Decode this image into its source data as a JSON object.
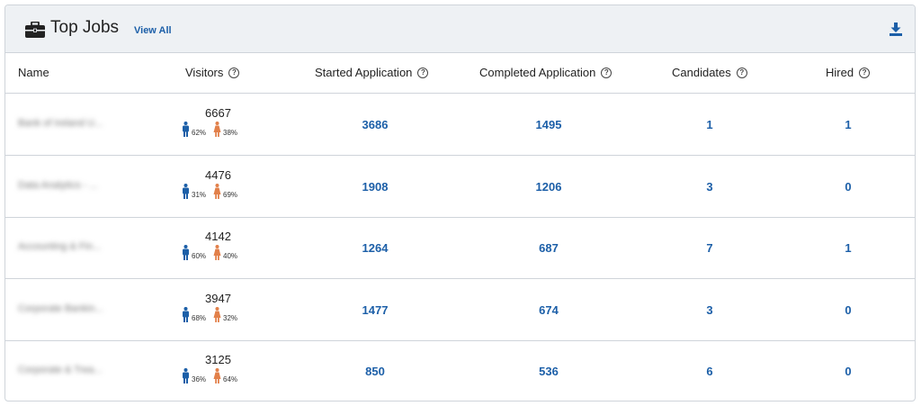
{
  "header": {
    "title": "Top Jobs",
    "view_all": "View All"
  },
  "columns": {
    "name": "Name",
    "visitors": "Visitors",
    "started": "Started Application",
    "completed": "Completed Application",
    "candidates": "Candidates",
    "hired": "Hired",
    "help_glyph": "?"
  },
  "rows": [
    {
      "name": "Bank of Ireland U...",
      "visitors": "6667",
      "male": "62%",
      "female": "38%",
      "started": "3686",
      "completed": "1495",
      "candidates": "1",
      "hired": "1"
    },
    {
      "name": "Data Analytics - ...",
      "visitors": "4476",
      "male": "31%",
      "female": "69%",
      "started": "1908",
      "completed": "1206",
      "candidates": "3",
      "hired": "0"
    },
    {
      "name": "Accounting & Fin...",
      "visitors": "4142",
      "male": "60%",
      "female": "40%",
      "started": "1264",
      "completed": "687",
      "candidates": "7",
      "hired": "1"
    },
    {
      "name": "Corporate Bankin...",
      "visitors": "3947",
      "male": "68%",
      "female": "32%",
      "started": "1477",
      "completed": "674",
      "candidates": "3",
      "hired": "0"
    },
    {
      "name": "Corporate & Trea...",
      "visitors": "3125",
      "male": "36%",
      "female": "64%",
      "started": "850",
      "completed": "536",
      "candidates": "6",
      "hired": "0"
    }
  ],
  "colors": {
    "accent": "#1c5fa8",
    "male": "#1c5fa8",
    "female": "#e2804a",
    "header_bg": "#eef1f4",
    "border": "#cfd4da"
  },
  "icons": {
    "title": "briefcase-icon",
    "download": "download-icon",
    "help": "help-circle-icon",
    "male": "male-person-icon",
    "female": "female-person-icon"
  }
}
